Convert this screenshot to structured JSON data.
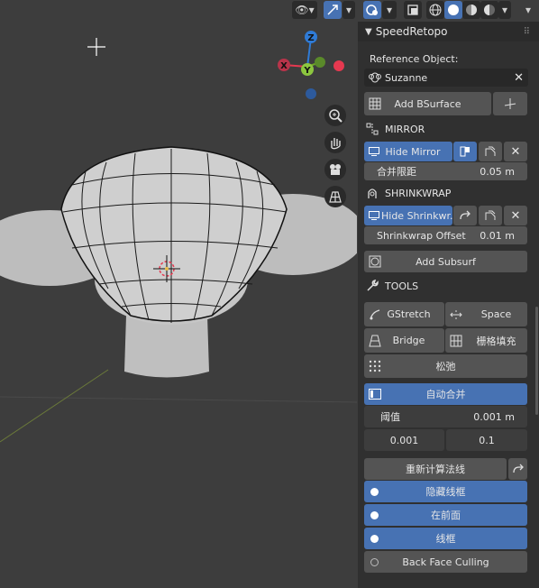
{
  "panel": {
    "title": "SpeedRetopo",
    "reference_label": "Reference Object:",
    "reference_value": "Suzanne",
    "add_bsurface": "Add BSurface",
    "mirror": {
      "title": "MIRROR",
      "hide_button": "Hide Mirror",
      "merge_label": "合并限距",
      "merge_value": "0.05 m"
    },
    "shrinkwrap": {
      "title": "SHRINKWRAP",
      "hide_button": "Hide Shrinkwr...",
      "offset_label": "Shrinkwrap Offset",
      "offset_value": "0.01 m"
    },
    "add_subsurf": "Add Subsurf",
    "tools": {
      "title": "TOOLS",
      "gstretch": "GStretch",
      "space": "Space",
      "bridge": "Bridge",
      "grid_fill": "栅格填充",
      "relax": "松弛"
    },
    "auto_merge": {
      "label": "自动合并",
      "threshold_label": "阈值",
      "threshold_value": "0.001 m",
      "value_a": "0.001",
      "value_b": "0.1"
    },
    "recalc_normals": "重新计算法线",
    "hide_wire": "隐藏线框",
    "in_front": "在前面",
    "wireframe": "线框",
    "backface_culling": "Back Face Culling"
  },
  "colors": {
    "accent": "#4772b3",
    "x_axis": "#e63950",
    "y_axis": "#6fa528",
    "z_axis": "#2f7bd6"
  },
  "gizmo": {
    "x": "X",
    "y": "Y",
    "z": "Z"
  },
  "icons": [
    "camera-view-icon",
    "gizmo-toggle-icon",
    "object-mode-icon",
    "overlay-icon",
    "wireframe-shading-icon",
    "solid-shading-icon",
    "material-shading-icon",
    "rendered-shading-icon",
    "zoom-icon",
    "hand-icon",
    "camera-icon",
    "grid-icon"
  ]
}
